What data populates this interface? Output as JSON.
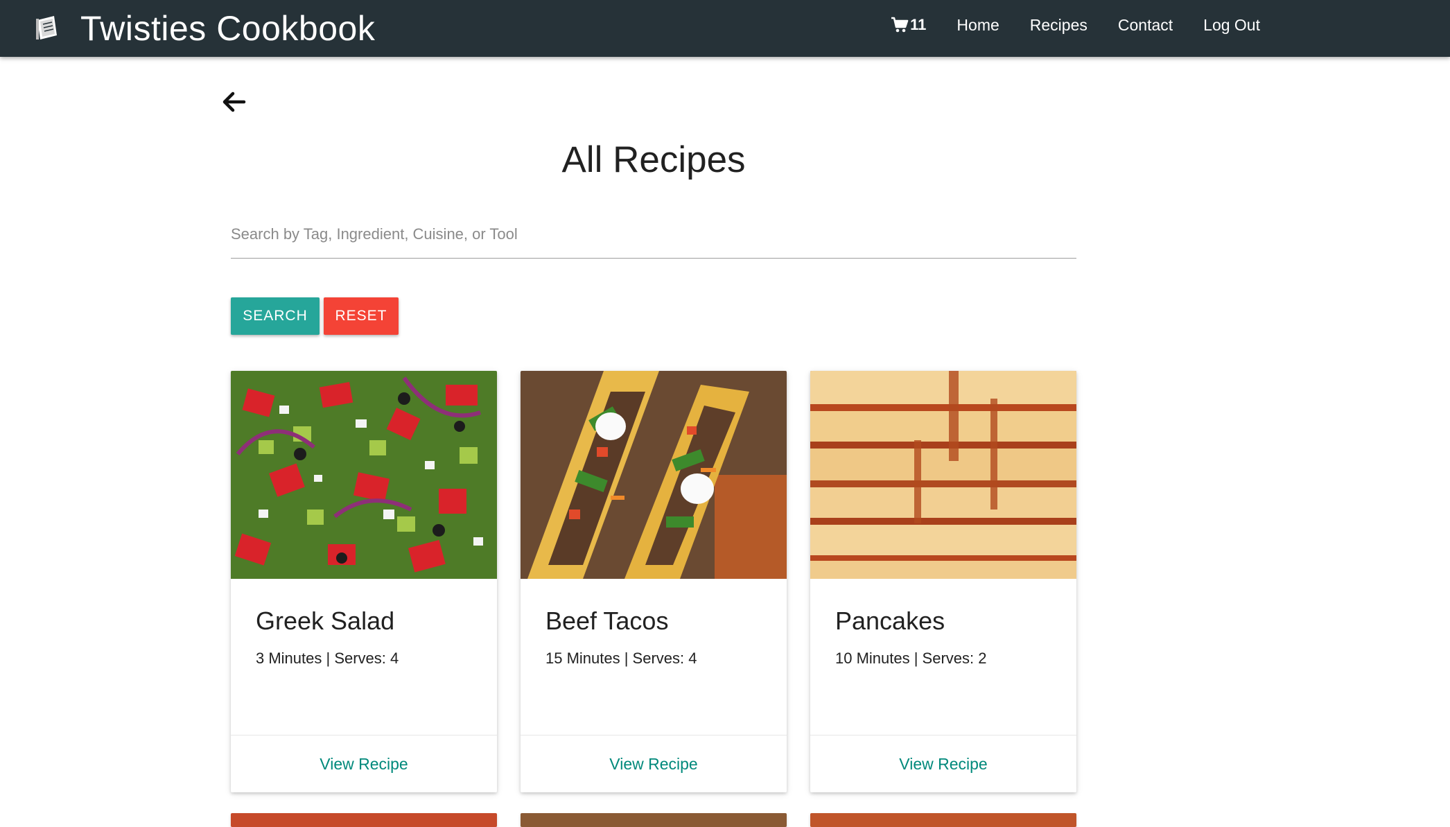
{
  "navbar": {
    "brand_title": "Twisties Cookbook",
    "cart_count": "11",
    "links": [
      "Home",
      "Recipes",
      "Contact",
      "Log Out"
    ]
  },
  "main": {
    "title": "All Recipes",
    "search_placeholder": "Search by Tag, Ingredient, Cuisine, or Tool",
    "search_value": "",
    "search_button": "SEARCH",
    "reset_button": "RESET"
  },
  "recipes": [
    {
      "name": "Greek Salad",
      "meta": "3 Minutes | Serves: 4",
      "action": "View Recipe"
    },
    {
      "name": "Beef Tacos",
      "meta": "15 Minutes | Serves: 4",
      "action": "View Recipe"
    },
    {
      "name": "Pancakes",
      "meta": "10 Minutes | Serves: 2",
      "action": "View Recipe"
    }
  ],
  "colors": {
    "navbar": "#263238",
    "search_button": "#26a69a",
    "reset_button": "#f44336",
    "link": "#00897b"
  },
  "icons": {
    "brand": "cookbook-icon",
    "cart": "cart-icon",
    "back": "arrow-left-icon"
  }
}
